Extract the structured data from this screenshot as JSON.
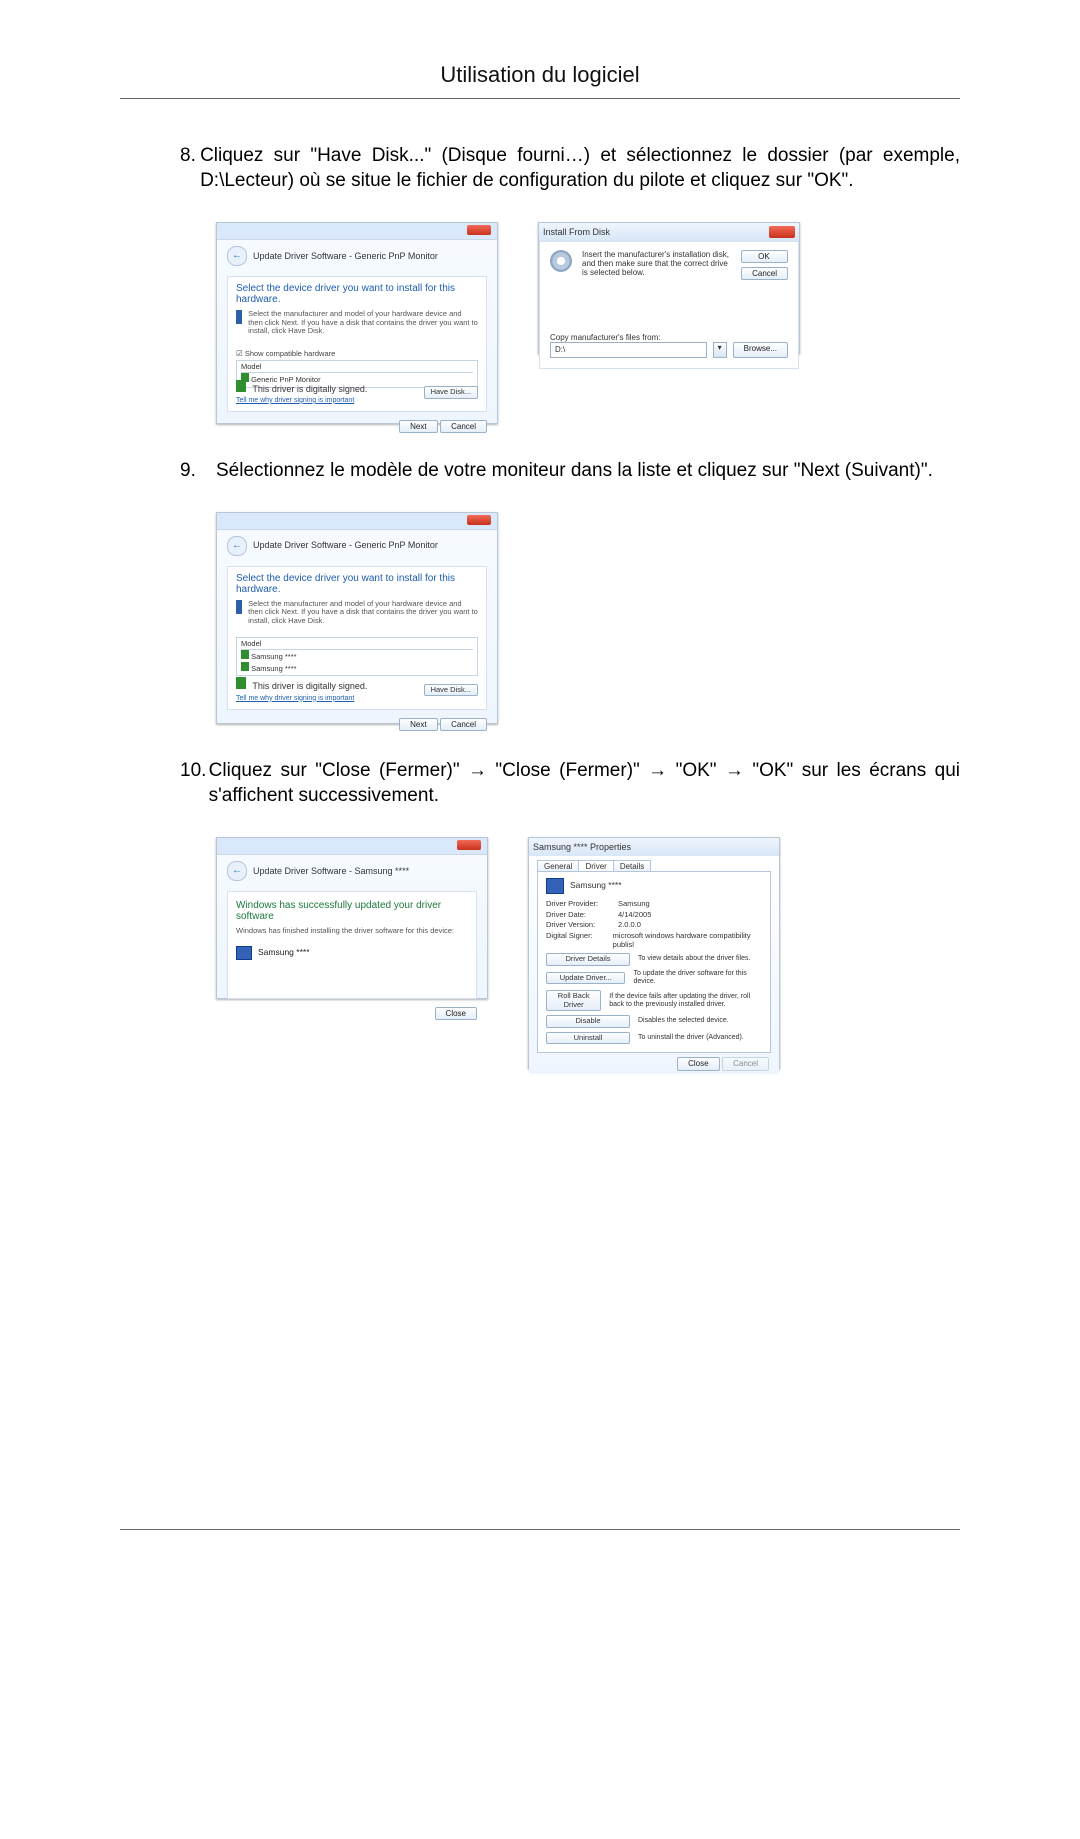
{
  "page": {
    "title": "Utilisation du logiciel"
  },
  "steps": {
    "n8": "8.",
    "t8": "Cliquez sur \"Have Disk...\" (Disque fourni…) et sélectionnez le dossier (par exemple, D:\\Lecteur) où se situe le fichier de configuration du pilote et cliquez sur \"OK\".",
    "n9": "9.",
    "t9": "Sélectionnez le modèle de votre moniteur dans la liste et cliquez sur \"Next (Suivant)\".",
    "n10": "10.",
    "t10": "Cliquez sur \"Close (Fermer)\" → \"Close (Fermer)\" → \"OK\" → \"OK\" sur les écrans qui s'affichent successivement."
  },
  "dlg_driver_generic": {
    "title": "Update Driver Software - Generic PnP Monitor",
    "head": "Select the device driver you want to install for this hardware.",
    "note": "Select the manufacturer and model of your hardware device and then click Next. If you have a disk that contains the driver you want to install, click Have Disk.",
    "show_compat": "Show compatible hardware",
    "model_hdr": "Model",
    "model_item": "Generic PnP Monitor",
    "signed": "This driver is digitally signed.",
    "tell_me": "Tell me why driver signing is important",
    "have_disk": "Have Disk...",
    "next": "Next",
    "cancel": "Cancel"
  },
  "dlg_install_from_disk": {
    "title": "Install From Disk",
    "msg": "Insert the manufacturer's installation disk, and then make sure that the correct drive is selected below.",
    "ok": "OK",
    "cancel": "Cancel",
    "copy_label": "Copy manufacturer's files from:",
    "path": "D:\\",
    "browse": "Browse..."
  },
  "dlg_driver_model": {
    "title": "Update Driver Software - Generic PnP Monitor",
    "head": "Select the device driver you want to install for this hardware.",
    "note": "Select the manufacturer and model of your hardware device and then click Next. If you have a disk that contains the driver you want to install, click Have Disk.",
    "model_hdr": "Model",
    "model1": "Samsung ****",
    "model2": "Samsung ****",
    "signed": "This driver is digitally signed.",
    "tell_me": "Tell me why driver signing is important",
    "have_disk": "Have Disk...",
    "next": "Next",
    "cancel": "Cancel"
  },
  "dlg_success": {
    "title": "Update Driver Software - Samsung ****",
    "head": "Windows has successfully updated your driver software",
    "note": "Windows has finished installing the driver software for this device:",
    "dev": "Samsung ****",
    "close": "Close"
  },
  "dlg_props": {
    "title": "Samsung **** Properties",
    "tab_general": "General",
    "tab_driver": "Driver",
    "tab_details": "Details",
    "dev": "Samsung ****",
    "provider_k": "Driver Provider:",
    "provider_v": "Samsung",
    "date_k": "Driver Date:",
    "date_v": "4/14/2005",
    "version_k": "Driver Version:",
    "version_v": "2.0.0.0",
    "signer_k": "Digital Signer:",
    "signer_v": "microsoft windows hardware compatibility publisl",
    "btn_details": "Driver Details",
    "btn_details_d": "To view details about the driver files.",
    "btn_update": "Update Driver...",
    "btn_update_d": "To update the driver software for this device.",
    "btn_roll": "Roll Back Driver",
    "btn_roll_d": "If the device fails after updating the driver, roll back to the previously installed driver.",
    "btn_disable": "Disable",
    "btn_disable_d": "Disables the selected device.",
    "btn_uninst": "Uninstall",
    "btn_uninst_d": "To uninstall the driver (Advanced).",
    "close": "Close",
    "cancel": "Cancel"
  }
}
